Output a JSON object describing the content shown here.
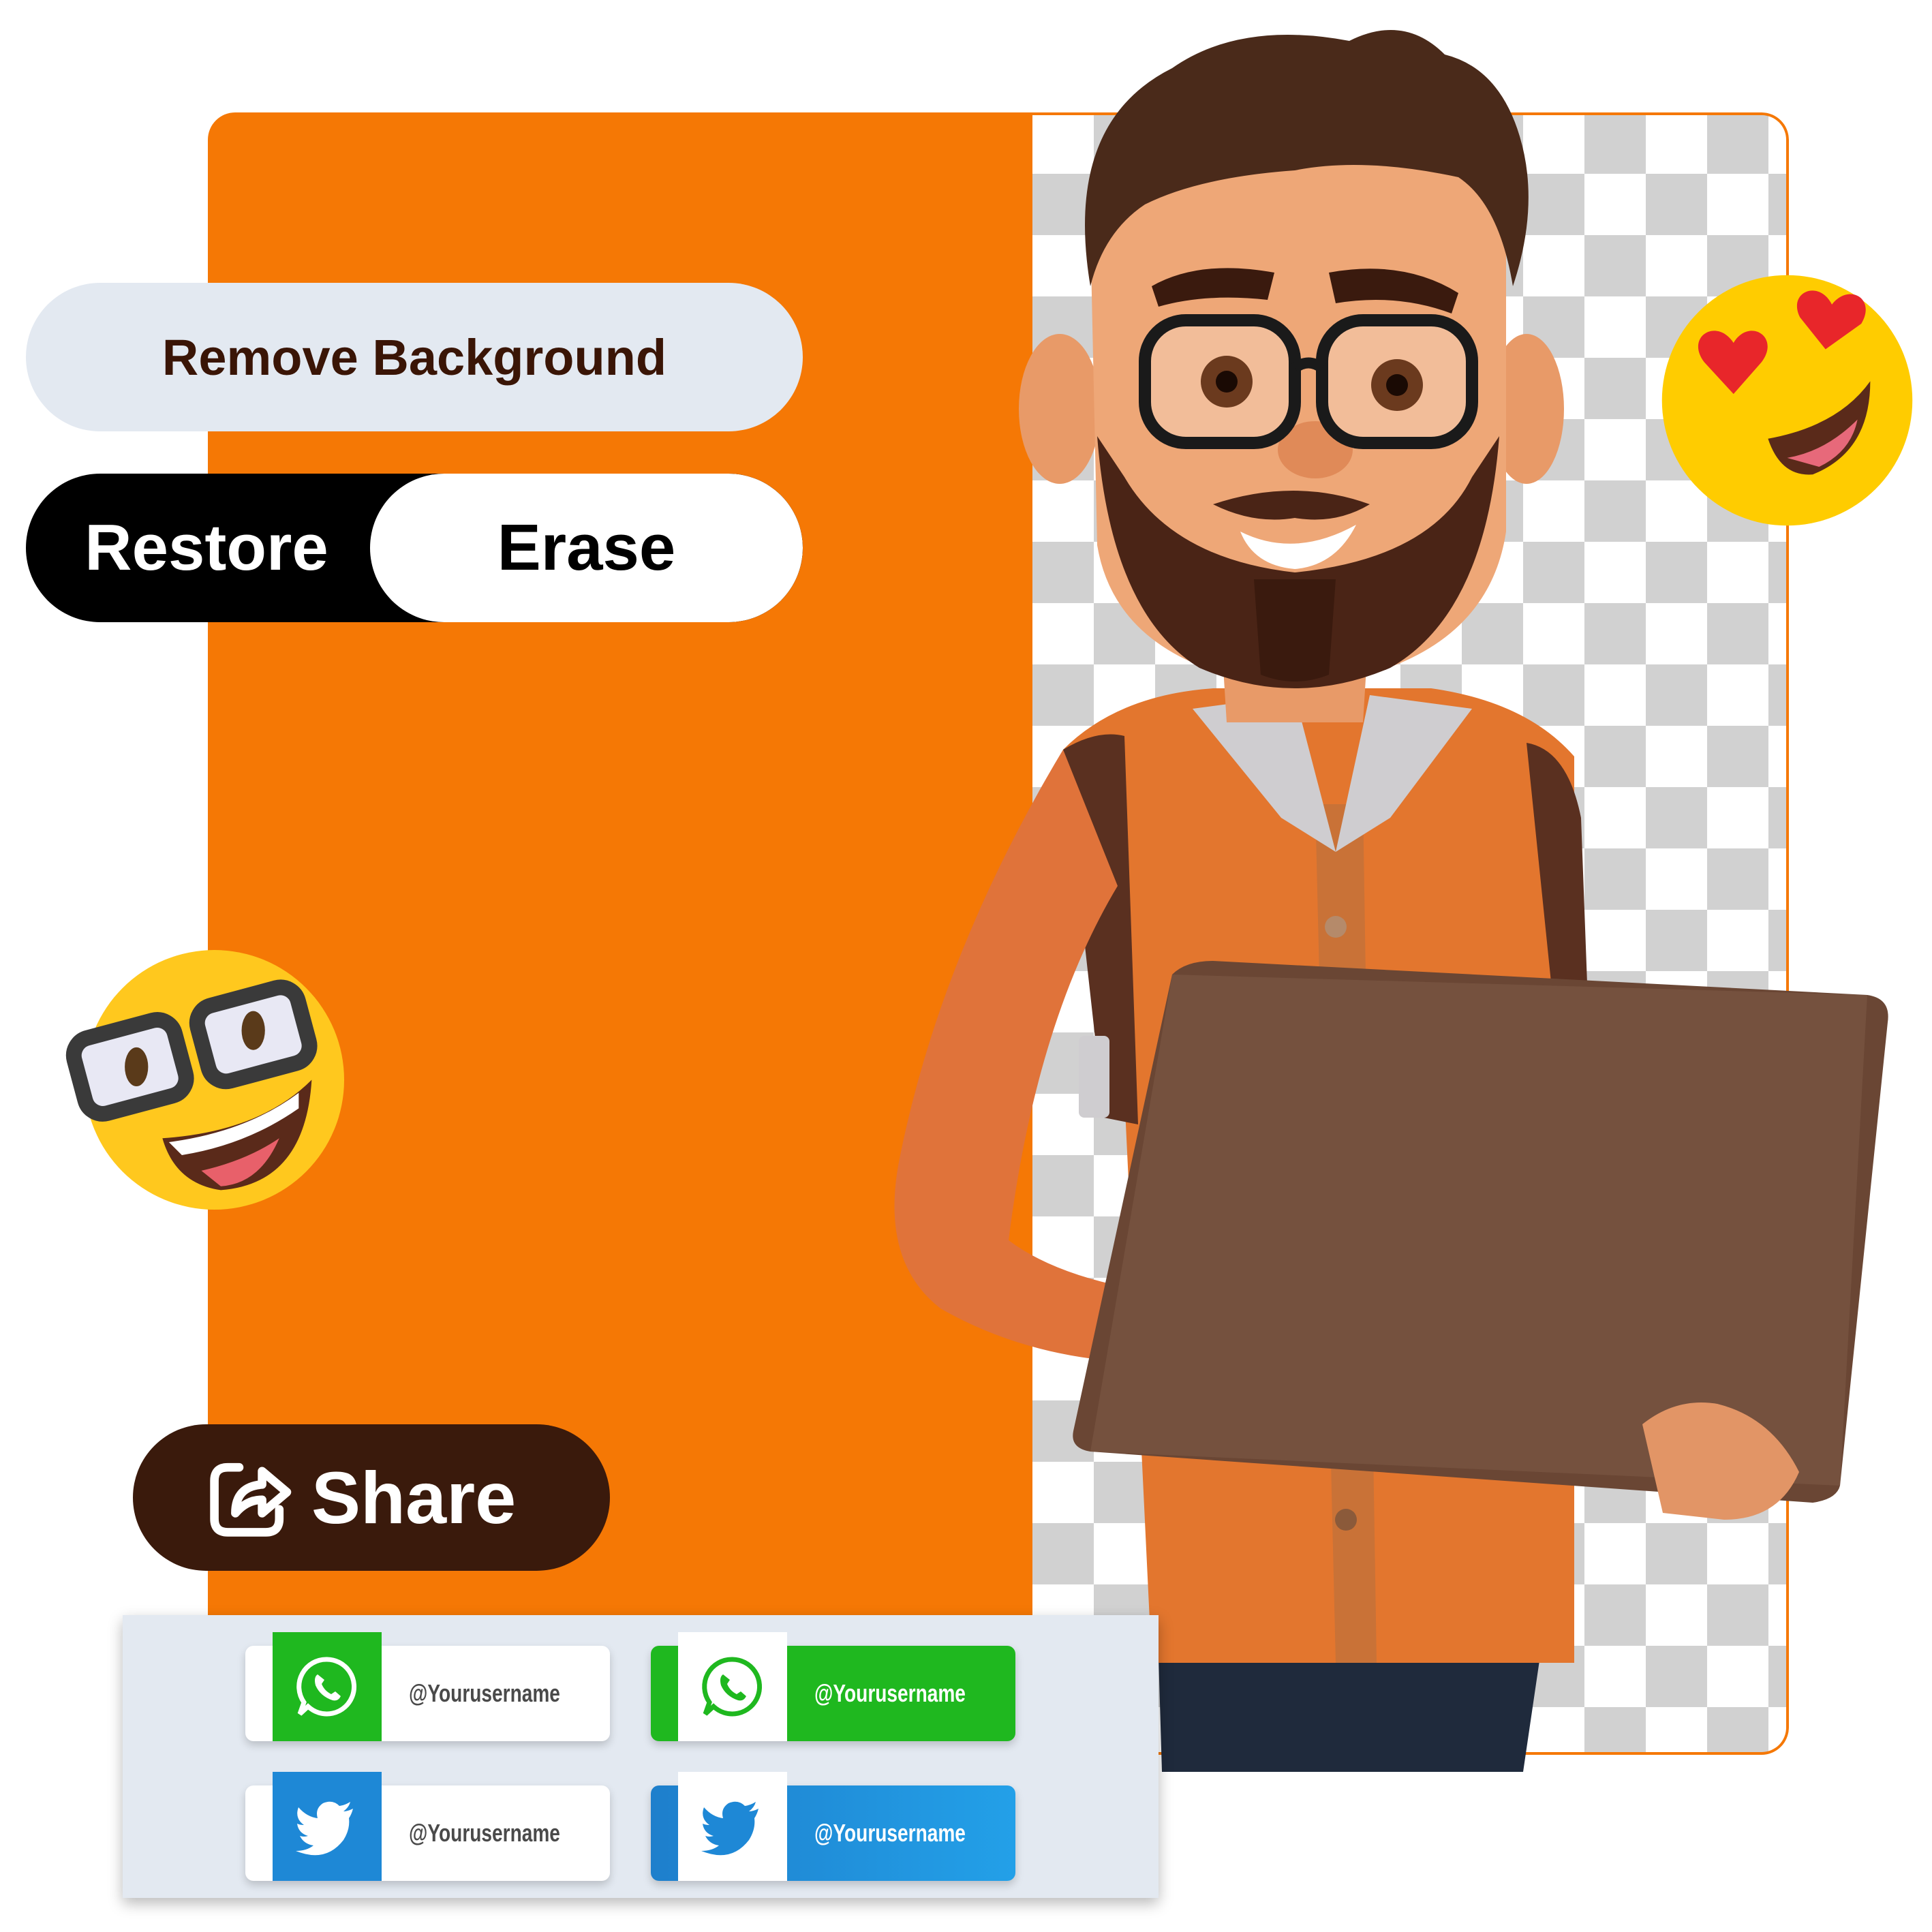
{
  "toolbar": {
    "remove_background_label": "Remove Background",
    "restore_label": "Restore",
    "erase_label": "Erase",
    "share_label": "Share"
  },
  "social_cards": [
    {
      "platform": "whatsapp",
      "style": "light",
      "handle": "@Yourusername"
    },
    {
      "platform": "whatsapp",
      "style": "filled",
      "handle": "@Yourusername"
    },
    {
      "platform": "twitter",
      "style": "light",
      "handle": "@Yourusername"
    },
    {
      "platform": "twitter",
      "style": "filled",
      "handle": "@Yourusername"
    }
  ],
  "icons": {
    "share": "share-icon",
    "whatsapp": "whatsapp-icon",
    "twitter": "twitter-bird-icon",
    "emoji_love": "heart-eyes-emoji-icon",
    "emoji_nerd": "nerd-glasses-emoji-icon"
  },
  "colors": {
    "accent_orange": "#F57805",
    "dark_brown": "#3A1A0C",
    "pill_light": "#E3E9F1",
    "whatsapp_green": "#1FB81F",
    "twitter_blue": "#1E88D6"
  }
}
